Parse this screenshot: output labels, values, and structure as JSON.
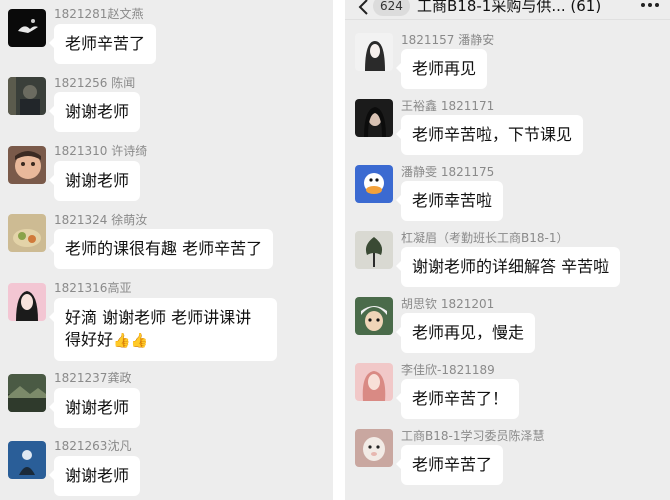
{
  "left": {
    "messages": [
      {
        "sender": "1821281赵文燕",
        "text": "老师辛苦了",
        "avatar": "black-bird-avatar"
      },
      {
        "sender": "1821256 陈闻",
        "text": "谢谢老师",
        "avatar": "dark-person-avatar"
      },
      {
        "sender": "1821310 许诗绮",
        "text": "谢谢老师",
        "avatar": "child-face-avatar"
      },
      {
        "sender": "1821324 徐萌汝",
        "text": "老师的课很有趣 老师辛苦了",
        "avatar": "food-avatar"
      },
      {
        "sender": "1821316高亚",
        "text_line1": "好滴 谢谢老师 老师讲课讲",
        "text_line2": "得好好",
        "emoji": "👍👍",
        "avatar": "pink-girl-avatar"
      },
      {
        "sender": "1821237龚政",
        "text": "谢谢老师",
        "avatar": "landscape-avatar"
      },
      {
        "sender": "1821263沈凡",
        "text": "谢谢老师",
        "avatar": "blue-figure-avatar"
      }
    ]
  },
  "right": {
    "header": {
      "unread_count": "624",
      "title": "工商B18-1采购与供... (61)"
    },
    "messages": [
      {
        "sender": "1821157 潘静安",
        "text": "老师再见",
        "avatar": "girl-sketch-avatar"
      },
      {
        "sender": "王裕鑫 1821171",
        "text": "老师辛苦啦，下节课见",
        "avatar": "dark-girl-avatar"
      },
      {
        "sender": "潘静雯 1821175",
        "text": "老师幸苦啦",
        "avatar": "cartoon-duck-avatar"
      },
      {
        "sender": "杠凝眉（考勤班长工商B18-1）",
        "text": "谢谢老师的详细解答 辛苦啦",
        "avatar": "tree-avatar"
      },
      {
        "sender": "胡思钦 1821201",
        "text": "老师再见，慢走",
        "avatar": "anime-boy-avatar"
      },
      {
        "sender": "李佳欣-1821189",
        "text": "老师辛苦了！",
        "avatar": "pink-woman-avatar"
      },
      {
        "sender": "工商B18-1学习委员陈泽慧",
        "text": "老师辛苦了",
        "avatar": "lamb-avatar"
      }
    ]
  }
}
